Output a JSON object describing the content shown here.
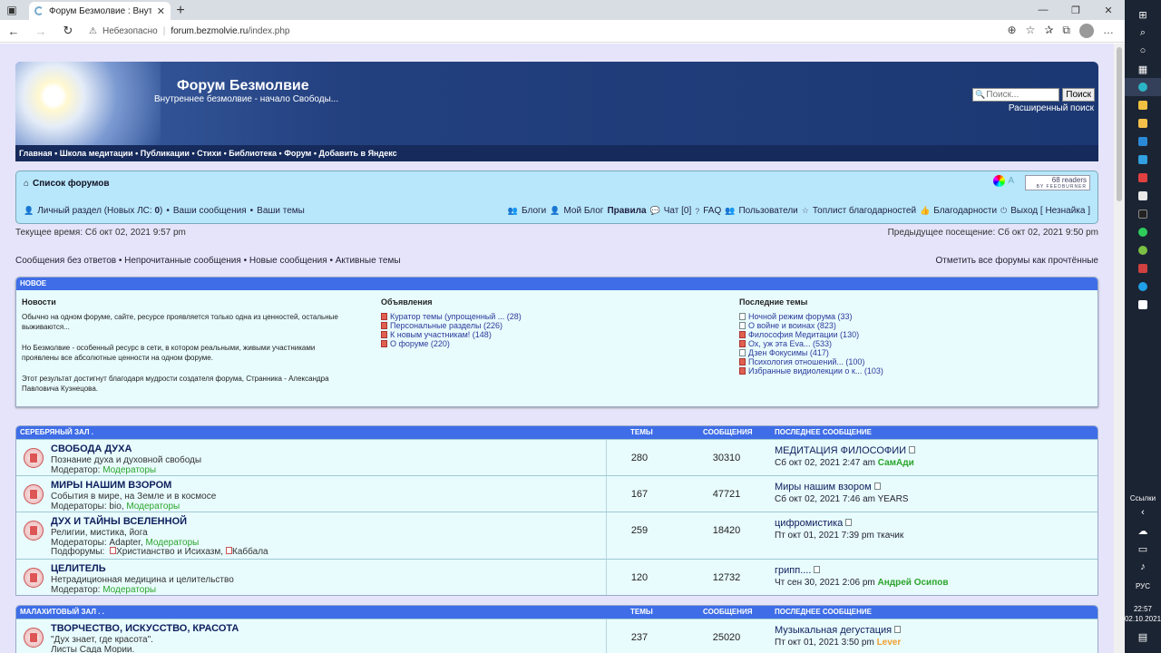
{
  "browser": {
    "tab_title": "Форум Безмолвие : Внутреннее",
    "new_tab": "+",
    "security": "Небезопасно",
    "url_host": "forum.bezmolvie.ru",
    "url_path": "/index.php"
  },
  "taskbar": {
    "links_label": "Ссылки",
    "lang": "РУС",
    "time": "22:57",
    "date": "02.10.2021"
  },
  "header": {
    "title": "Форум Безмолвие",
    "subtitle": "Внутреннее безмолвие - начало Свободы...",
    "search_placeholder": "Поиск...",
    "search_button": "Поиск",
    "advanced_search": "Расширенный поиск",
    "nav": [
      "Главная",
      "Школа медитации",
      "Публикации",
      "Стихи",
      "Библиотека",
      "Форум",
      "Добавить в Яндекс"
    ]
  },
  "navbar": {
    "forum_list": "Список форумов",
    "readers": "68 readers",
    "feed_by": "BY FEEDBURNER",
    "font_ctrl": "A",
    "personal": "Личный раздел (Новых ЛС: ",
    "personal_count": "0",
    "personal_close": ")",
    "your_posts": "Ваши сообщения",
    "your_topics": "Ваши темы",
    "blogs": "Блоги",
    "my_blog": "Мой Блог",
    "rules": "Правила",
    "chat": "Чат [0]",
    "faq": "FAQ",
    "users": "Пользователи",
    "top_thanks": "Топлист благодарностей",
    "thanks": "Благодарности",
    "logout": "Выход [ Незнайка ]"
  },
  "times": {
    "current": "Текущее время: Сб окт 02, 2021 9:57 pm",
    "previous": "Предыдущее посещение: Сб окт 02, 2021 9:50 pm"
  },
  "quick": {
    "links": [
      "Сообщения без ответов",
      "Непрочитанные сообщения",
      "Новые сообщения",
      "Активные темы"
    ],
    "mark_all": "Отметить все форумы как прочтённые"
  },
  "new_box": {
    "header": "НОВОЕ",
    "news_title": "Новости",
    "news": [
      "Обычно на одном форуме, сайте, ресурсе проявляется только одна из ценностей, остальные выживаются...",
      "Но Безмолвие - особенный ресурс в сети, в котором реальными, живыми участниками проявлены все абсолютные ценности на одном форуме.",
      "Этот результат достигнут благодаря мудрости создателя форума, Странника - Александра Павловича Кузнецова."
    ],
    "ann_title": "Объявления",
    "announcements": [
      "Куратор темы (упрощенный ... (28)",
      "Персональные разделы (226)",
      "К новым участникам! (148)",
      "О форуме (220)"
    ],
    "latest_title": "Последние темы",
    "latest": [
      "Ночной режим форума (33)",
      "О войне и воинах (823)",
      "Философия Медитации (130)",
      "Ох, уж эта Eva... (533)",
      "Дзен Фокусимы (417)",
      "Психология отношений... (100)",
      "Избранные видиолекции о к... (103)"
    ]
  },
  "sections": [
    {
      "title": "СЕРЕБРЯНЫЙ ЗАЛ .",
      "col_topics": "ТЕМЫ",
      "col_posts": "СООБЩЕНИЯ",
      "col_last": "ПОСЛЕДНЕЕ СООБЩЕНИЕ",
      "forums": [
        {
          "name": "СВОБОДА ДУХА",
          "desc": "Познание духа и духовной свободы",
          "mods_label": "Модератор: ",
          "mods_plain": "",
          "mods_green": "Модераторы",
          "topics": "280",
          "posts": "30310",
          "last_title": "МЕДИТАЦИЯ ФИЛОСОФИИ",
          "last_date": "Сб окт 02, 2021 2:47 am ",
          "last_user": "СамАди",
          "user_color": "green"
        },
        {
          "name": "МИРЫ НАШИМ ВЗОРОМ",
          "desc": "События в мире, на Земле и в космосе",
          "mods_label": "Модераторы: ",
          "mods_plain": "bio, ",
          "mods_green": "Модераторы",
          "topics": "167",
          "posts": "47721",
          "last_title": "Миры нашим взором",
          "last_date": "Сб окт 02, 2021 7:46 am ",
          "last_user": "YEARS",
          "user_color": "plain"
        },
        {
          "name": "ДУХ И ТАЙНЫ ВСЕЛЕННОЙ",
          "desc": "Религии, мистика, йога",
          "mods_label": "Модераторы: ",
          "mods_plain": "Adapter, ",
          "mods_green": "Модераторы",
          "subs_label": "Подфорумы: ",
          "subs": [
            "Христианство и Исихазм,",
            "Каббала"
          ],
          "topics": "259",
          "posts": "18420",
          "last_title": "цифромистика",
          "last_date": "Пт окт 01, 2021 7:39 pm ",
          "last_user": "ткачик",
          "user_color": "plain"
        },
        {
          "name": "ЦЕЛИТЕЛЬ",
          "desc": "Нетрадиционная медицина и целительство",
          "mods_label": "Модератор: ",
          "mods_plain": "",
          "mods_green": "Модераторы",
          "topics": "120",
          "posts": "12732",
          "last_title": "грипп....",
          "last_date": "Чт сен 30, 2021 2:06 pm ",
          "last_user": "Андрей Осипов",
          "user_color": "green"
        }
      ]
    },
    {
      "title": "МАЛАХИТОВЫЙ ЗАЛ . .",
      "col_topics": "ТЕМЫ",
      "col_posts": "СООБЩЕНИЯ",
      "col_last": "ПОСЛЕДНЕЕ СООБЩЕНИЕ",
      "forums": [
        {
          "name": "ТВОРЧЕСТВО, ИСКУССТВО, КРАСОТА",
          "desc": "\"Дух знает, где красота\".",
          "mods_label": "Листы Сада Мории.",
          "mods_plain": "",
          "mods_green": "",
          "topics": "237",
          "posts": "25020",
          "last_title": "Музыкальная дегустация",
          "last_date": "Пт окт 01, 2021 3:50 pm ",
          "last_user": "Lever",
          "user_color": "orange"
        }
      ]
    }
  ]
}
